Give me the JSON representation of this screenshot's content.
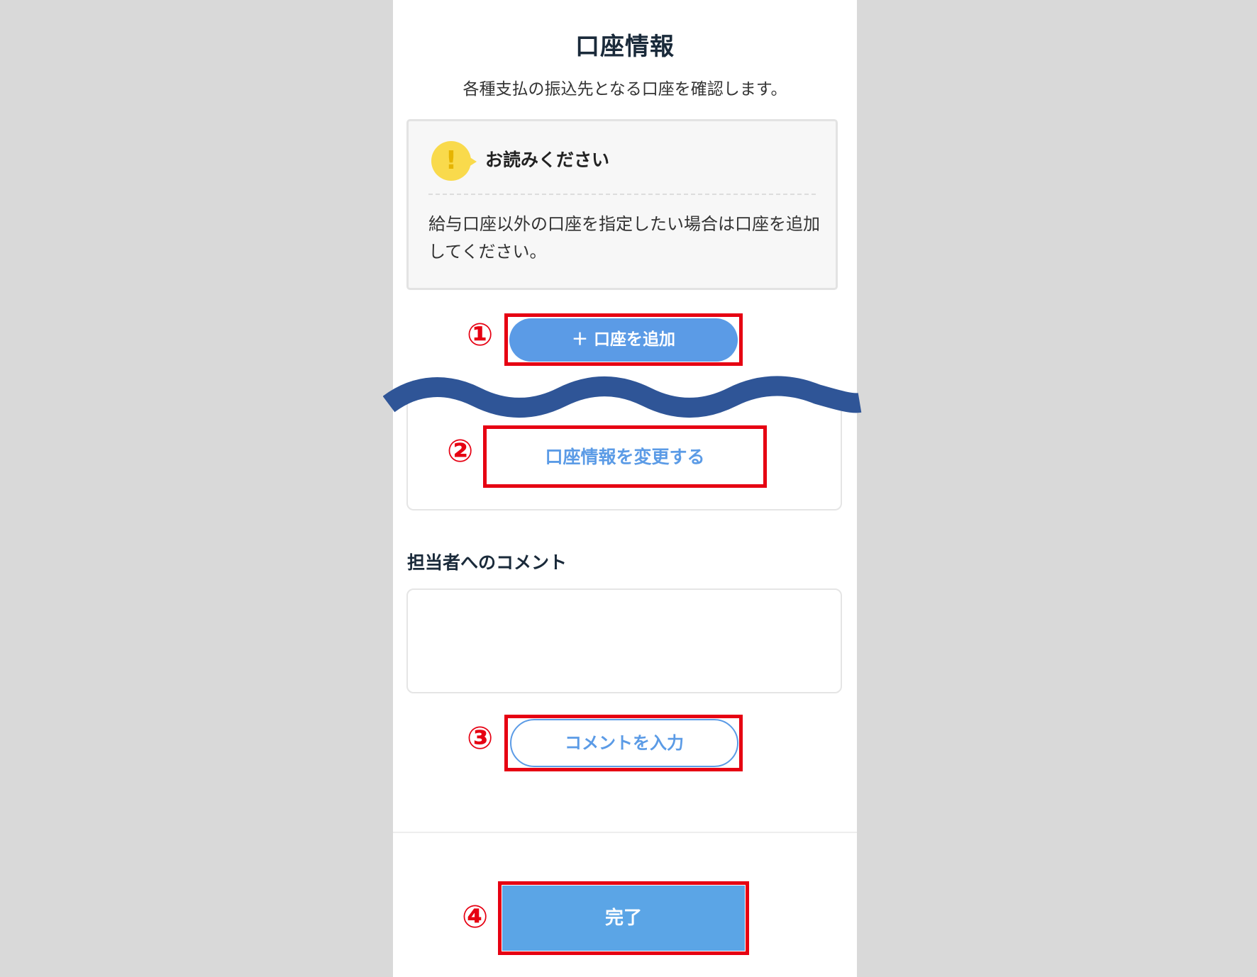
{
  "header": {
    "title": "口座情報",
    "subtitle": "各種支払の振込先となる口座を確認します。"
  },
  "notice": {
    "heading": "お読みください",
    "icon": "exclamation-icon",
    "body": "給与口座以外の口座を指定したい場合は口座を追加してください。"
  },
  "actions": {
    "add_account_label": "＋ 口座を追加",
    "change_account_label": "口座情報を変更する",
    "enter_comment_label": "コメントを入力",
    "done_label": "完了"
  },
  "comment": {
    "label": "担当者へのコメント",
    "value": ""
  },
  "markers": [
    "①",
    "②",
    "③",
    "④"
  ],
  "colors": {
    "accent": "#5b9be6",
    "done_button": "#5ba5e6",
    "highlight": "#e60012",
    "wave": "#2f5597",
    "notice_icon": "#f9da4c"
  }
}
